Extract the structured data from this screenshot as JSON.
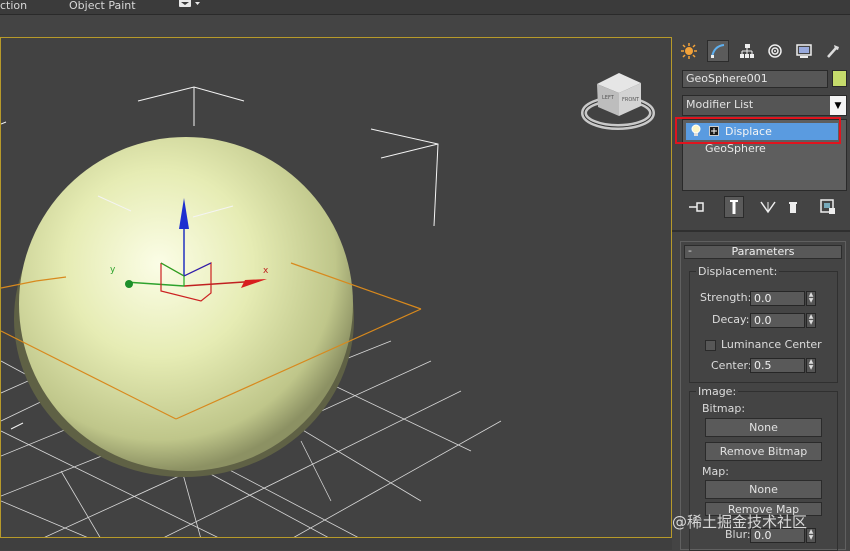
{
  "menubar": {
    "items": [
      "ction",
      "Object Paint"
    ]
  },
  "viewcube": {
    "faces": [
      "LEFT",
      "FRONT"
    ]
  },
  "axes": {
    "x": "x",
    "y": "y"
  },
  "command_panel": {
    "tabs": [
      "create-icon",
      "modify-icon",
      "hierarchy-icon",
      "motion-icon",
      "display-icon",
      "utilities-icon"
    ],
    "object_name": "GeoSphere001",
    "object_color": "#c6dc6c",
    "modifier_list_label": "Modifier List",
    "stack": {
      "items": [
        {
          "label": "Displace",
          "selected": true
        },
        {
          "label": "GeoSphere",
          "selected": false
        }
      ]
    },
    "stack_tools": [
      "pin-stack-icon",
      "show-end-result-icon",
      "make-unique-icon",
      "remove-modifier-icon",
      "configure-modifier-sets-icon"
    ],
    "rollout": {
      "title": "Parameters",
      "displacement": {
        "label": "Displacement:",
        "strength_label": "Strength:",
        "strength_value": "0.0",
        "decay_label": "Decay:",
        "decay_value": "0.0",
        "luminance_center_label": "Luminance Center",
        "luminance_center_checked": false,
        "center_label": "Center:",
        "center_value": "0.5"
      },
      "image": {
        "label": "Image:",
        "bitmap_label": "Bitmap:",
        "bitmap_button": "None",
        "remove_bitmap_button": "Remove Bitmap",
        "map_label": "Map:",
        "map_button": "None",
        "remove_map_button": "Remove Map",
        "blur_label": "Blur:",
        "blur_value": "0.0"
      }
    }
  },
  "watermark": "@稀土掘金技术社区",
  "colors": {
    "selection": "#5a9be0",
    "highlight": "#e0141e",
    "viewport_border": "#b79a2a",
    "geosphere": "#dfe6a6"
  }
}
